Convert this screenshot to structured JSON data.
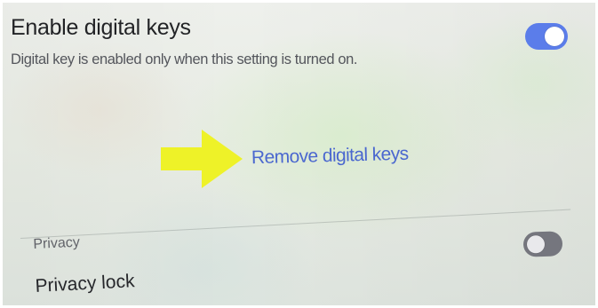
{
  "digital_keys": {
    "title": "Enable digital keys",
    "description": "Digital key is enabled only when this setting is turned on.",
    "toggle_state": "on",
    "remove_link": "Remove digital keys"
  },
  "privacy": {
    "section_header": "Privacy",
    "lock_label": "Privacy lock",
    "toggle_state": "off"
  },
  "colors": {
    "toggle_on": "#5b7dea",
    "toggle_off": "#75767e",
    "link": "#4a67cf",
    "annotation_arrow": "#eef228"
  },
  "icons": {
    "annotation": "right-arrow-icon"
  }
}
